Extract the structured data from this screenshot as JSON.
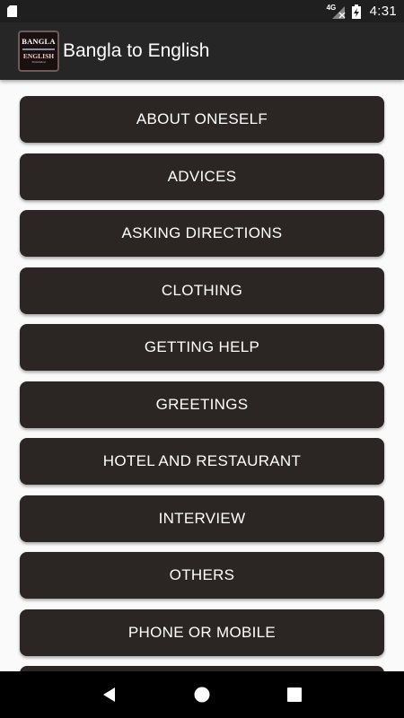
{
  "status_bar": {
    "network": "4G",
    "time": "4:31"
  },
  "app_bar": {
    "logo": {
      "line1": "BANGLA",
      "line2": "ENGLISH",
      "line3": "Translation"
    },
    "title": "Bangla to English"
  },
  "categories": [
    "ABOUT ONESELF",
    "ADVICES",
    "ASKING DIRECTIONS",
    "CLOTHING",
    "GETTING HELP",
    "GREETINGS",
    "HOTEL AND RESTAURANT",
    "INTERVIEW",
    "OTHERS",
    "PHONE OR MOBILE",
    ""
  ],
  "nav_bar": {
    "back_icon": "back-triangle",
    "home_icon": "home-circle",
    "recents_icon": "recents-square"
  },
  "colors": {
    "status_bar": "#1f1f1f",
    "app_bar": "#262626",
    "button": "#2b2624",
    "background": "#fafafa"
  }
}
